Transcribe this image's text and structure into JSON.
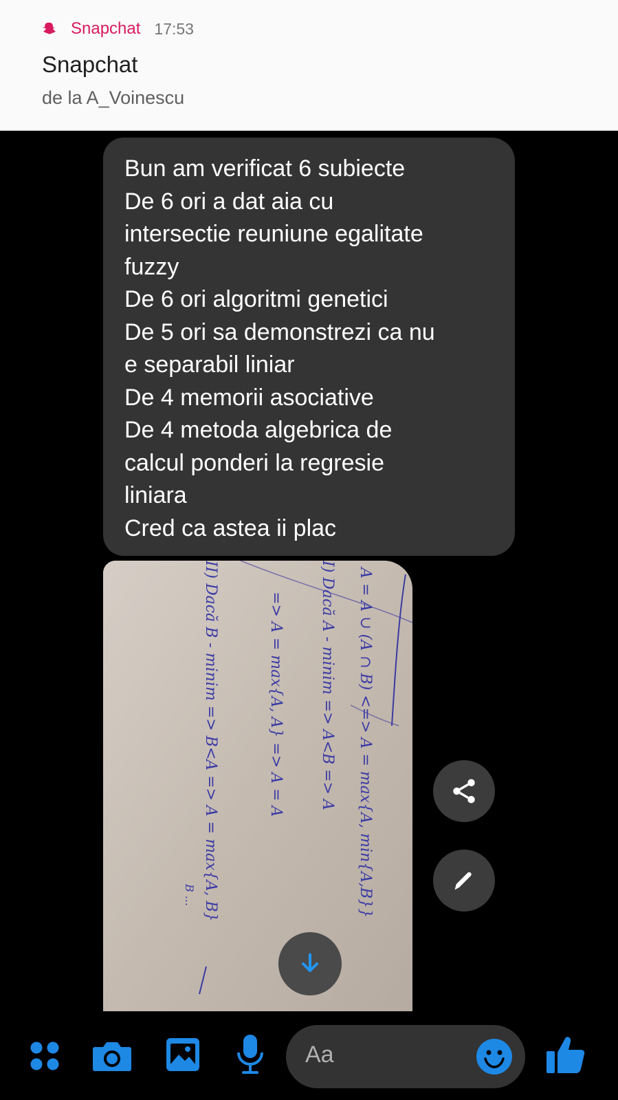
{
  "notification": {
    "app_name": "Snapchat",
    "time": "17:53",
    "title": "Snapchat",
    "subtitle": "de la A_Voinescu",
    "accent_color": "#d81b60"
  },
  "message": {
    "lines": [
      "Bun am verificat 6 subiecte",
      "De 6 ori a dat aia cu",
      "intersectie reuniune egalitate",
      "fuzzy",
      "De 6 ori algoritmi genetici",
      "De 5 ori sa demonstrezi ca nu",
      "e separabil liniar",
      "De 4 memorii asociative",
      "De 4 metoda algebrica de",
      "calcul ponderi la regresie",
      "liniara",
      "Cred ca astea ii plac"
    ]
  },
  "photo": {
    "alt": "handwritten notes photo",
    "handwriting": [
      "A = A ∪ (A ∩ B) <=> A = max{A, min{A,B}}",
      "I) Dacă A - minim => A<B => A",
      "=> A = max{A, A} => A = A",
      "II) Dacă B - minim => B<A => A = max{A, B}",
      "B ..."
    ]
  },
  "actions": {
    "share_icon": "share-icon",
    "edit_icon": "pencil-icon",
    "scroll_icon": "arrow-down-icon"
  },
  "composer": {
    "placeholder": "Aa",
    "icons": [
      "apps-icon",
      "camera-icon",
      "image-icon",
      "microphone-icon",
      "emoji-icon",
      "thumbs-up-icon"
    ],
    "icon_color": "#1e88e5"
  }
}
